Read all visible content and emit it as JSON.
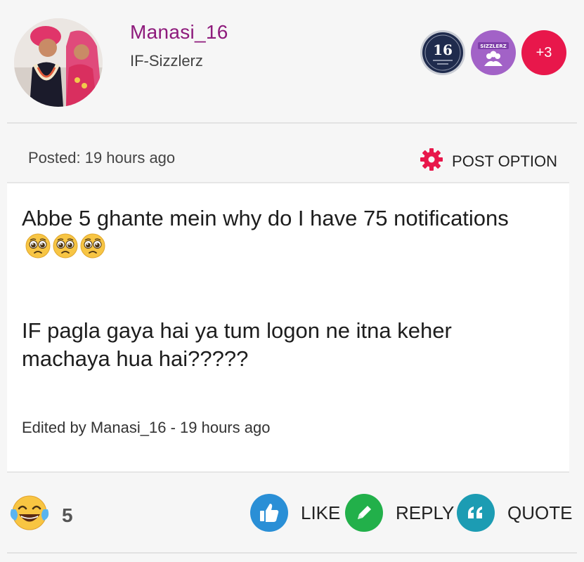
{
  "user": {
    "name": "Manasi_16",
    "group": "IF-Sizzlerz"
  },
  "badges": {
    "anniversary_number": "16",
    "group_badge_text": "SIZZLERZ",
    "more_count": "+3",
    "colors": {
      "anniversary": "#1f2b4d",
      "group": "#a262c7",
      "more": "#e8174b"
    }
  },
  "post_meta": {
    "posted_label": "Posted: 19 hours ago",
    "post_option_label": "POST OPTION",
    "post_option_icon": "gear-icon",
    "accent_color": "#e8174b"
  },
  "body": {
    "paragraph1": "Abbe 5 ghante mein why do I have 75 notifications",
    "paragraph1_emojis": [
      "pleading-face-icon",
      "pleading-face-icon",
      "pleading-face-icon"
    ],
    "paragraph2": "IF pagla gaya hai ya tum logon ne itna keher machaya hua hai?????",
    "edited_label": "Edited by Manasi_16 - 19 hours ago"
  },
  "footer": {
    "reaction_icon": "laughing-tears-icon",
    "reaction_count": "5",
    "like_label": "LIKE",
    "like_color": "#2a8fd6",
    "reply_label": "REPLY",
    "reply_color": "#22b04a",
    "quote_label": "QUOTE",
    "quote_color": "#1c9cb3"
  }
}
